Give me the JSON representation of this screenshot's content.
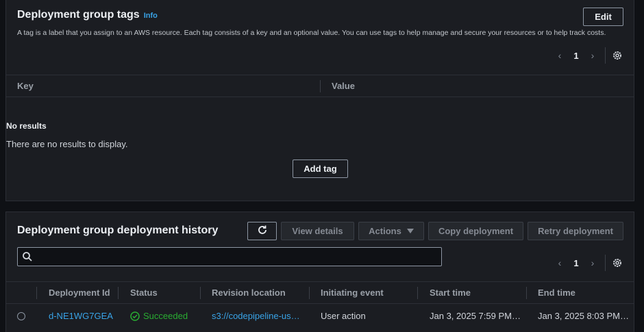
{
  "tags": {
    "title": "Deployment group tags",
    "info": "Info",
    "edit_label": "Edit",
    "description": "A tag is a label that you assign to an AWS resource. Each tag consists of a key and an optional value. You can use tags to help manage and secure your resources or to help track costs.",
    "page": "1",
    "columns": [
      "Key",
      "Value"
    ],
    "empty_title": "No results",
    "empty_message": "There are no results to display.",
    "add_tag_label": "Add tag"
  },
  "history": {
    "title": "Deployment group deployment history",
    "buttons": {
      "view_details": "View details",
      "actions": "Actions",
      "copy": "Copy deployment",
      "retry": "Retry deployment"
    },
    "search": {
      "value": "",
      "placeholder": ""
    },
    "page": "1",
    "columns": [
      "Deployment Id",
      "Status",
      "Revision location",
      "Initiating event",
      "Start time",
      "End time"
    ],
    "rows": [
      {
        "deployment_id": "d-NE1WG7GEA",
        "status": "Succeeded",
        "revision_location": "s3://codepipeline-us…",
        "initiating_event": "User action",
        "start_time": "Jan 3, 2025 7:59 PM…",
        "end_time": "Jan 3, 2025 8:03 PM…"
      }
    ]
  },
  "icons": {
    "chevron_left": "chevron-left-icon",
    "chevron_right": "chevron-right-icon",
    "gear": "gear-icon",
    "refresh": "refresh-icon",
    "search": "search-icon",
    "caret_down": "caret-down-icon",
    "status_ok": "check-circle-icon"
  },
  "colors": {
    "accent_link": "#39a4e8",
    "success": "#29ad32",
    "panel_bg": "#1b1d22",
    "page_bg": "#0f1115"
  }
}
